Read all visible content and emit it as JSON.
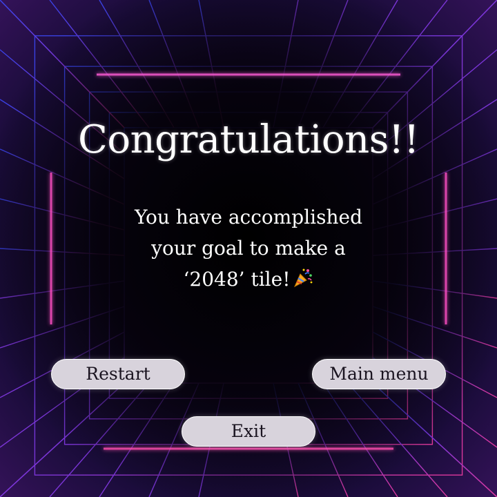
{
  "dialog": {
    "title": "Congratulations!!",
    "message_line1": "You have accomplished",
    "message_line2": "your goal to make a",
    "message_line3": "‘2048’ tile!",
    "emoji": "party-popper-icon"
  },
  "buttons": {
    "restart_label": "Restart",
    "main_menu_label": "Main menu",
    "exit_label": "Exit"
  },
  "colors": {
    "grid_blue": "#3b4cff",
    "grid_magenta": "#ff3fb0",
    "glow_pink": "#ff4fd0",
    "button_fill": "#d8d3dc"
  }
}
